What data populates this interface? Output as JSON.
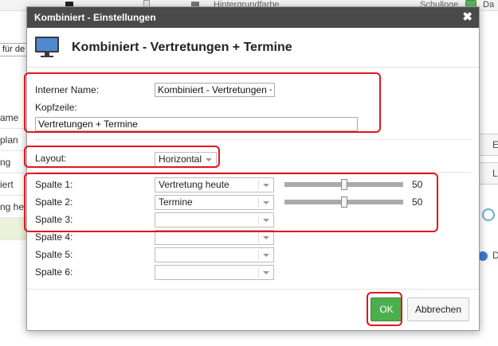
{
  "background": {
    "top_label": "Hintergrundfarbe",
    "top_right_label": "Schulloge",
    "top_right_da": "Da",
    "left_input_text": "für de",
    "left_list": [
      "ame",
      "plan",
      "ng",
      "iert",
      "ng he"
    ],
    "right_buttons": [
      "E",
      "L"
    ],
    "right_d": "D"
  },
  "dialog": {
    "title": "Kombiniert - Einstellungen",
    "close": "✖",
    "header_title": "Kombiniert - Vertretungen + Termine",
    "internal_name_label": "Interner Name:",
    "internal_name_value": "Kombiniert - Vertretungen +",
    "kopfzeile_label": "Kopfzeile:",
    "kopfzeile_value": "Vertretungen + Termine",
    "layout_label": "Layout:",
    "layout_value": "Horizontal",
    "columns": [
      {
        "label": "Spalte 1:",
        "value": "Vertretung heute",
        "width": "50",
        "width_fraction": 0.5
      },
      {
        "label": "Spalte 2:",
        "value": "Termine",
        "width": "50",
        "width_fraction": 0.5
      },
      {
        "label": "Spalte 3:",
        "value": ""
      },
      {
        "label": "Spalte 4:",
        "value": ""
      },
      {
        "label": "Spalte 5:",
        "value": ""
      },
      {
        "label": "Spalte 6:",
        "value": ""
      }
    ],
    "ok_label": "OK",
    "cancel_label": "Abbrechen"
  }
}
